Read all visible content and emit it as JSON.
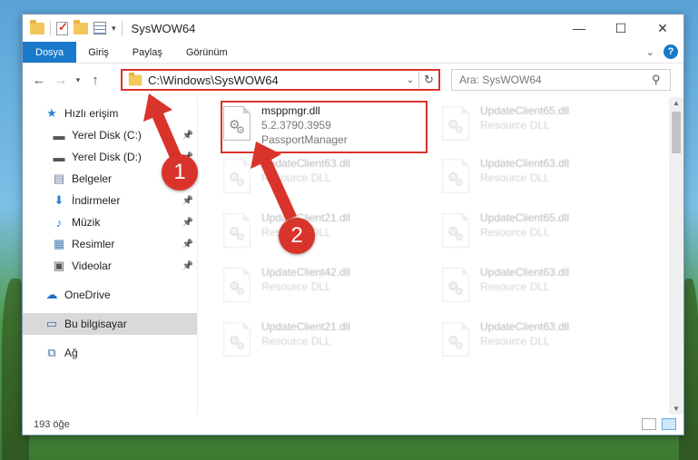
{
  "window": {
    "title": "SysWOW64",
    "controls": [
      "—",
      "☐",
      "✕"
    ]
  },
  "ribbon": {
    "tabs": [
      {
        "label": "Dosya",
        "active": true
      },
      {
        "label": "Giriş"
      },
      {
        "label": "Paylaş"
      },
      {
        "label": "Görünüm"
      }
    ],
    "help": "?"
  },
  "address": {
    "path": "C:\\Windows\\SysWOW64",
    "search_placeholder": "Ara: SysWOW64"
  },
  "sidebar": {
    "items": [
      {
        "label": "Hızlı erişim",
        "icon": "star-icon",
        "level": 0
      },
      {
        "label": "Yerel Disk (C:)",
        "icon": "drive-icon",
        "level": 1,
        "pinned": true
      },
      {
        "label": "Yerel Disk (D:)",
        "icon": "drive-icon",
        "level": 1,
        "pinned": true
      },
      {
        "label": "Belgeler",
        "icon": "documents-icon",
        "level": 1,
        "pinned": true
      },
      {
        "label": "İndirmeler",
        "icon": "download-icon",
        "level": 1,
        "pinned": true
      },
      {
        "label": "Müzik",
        "icon": "music-icon",
        "level": 1,
        "pinned": true
      },
      {
        "label": "Resimler",
        "icon": "pictures-icon",
        "level": 1,
        "pinned": true
      },
      {
        "label": "Videolar",
        "icon": "video-icon",
        "level": 1,
        "pinned": true
      },
      {
        "label": "OneDrive",
        "icon": "cloud-icon",
        "level": 0
      },
      {
        "label": "Bu bilgisayar",
        "icon": "computer-icon",
        "level": 0,
        "selected": true
      },
      {
        "label": "Ağ",
        "icon": "network-icon",
        "level": 0
      }
    ]
  },
  "files": [
    {
      "name": "msppmgr.dll",
      "line2": "5.2.3790.3959",
      "line3": "PassportManager",
      "faded": false
    },
    {
      "name": "UpdateClient65.dll",
      "line2": "Resource DLL",
      "faded": true
    },
    {
      "name": "UpdateClient63.dll",
      "line2": "Resource DLL",
      "faded": true
    },
    {
      "name": "UpdateClient63.dll",
      "line2": "Resource DLL",
      "faded": true
    },
    {
      "name": "UpdateClient21.dll",
      "line2": "Resource DLL",
      "faded": true
    },
    {
      "name": "UpdateClient65.dll",
      "line2": "Resource DLL",
      "faded": true
    },
    {
      "name": "UpdateClient42.dll",
      "line2": "Resource DLL",
      "faded": true
    },
    {
      "name": "UpdateClient63.dll",
      "line2": "Resource DLL",
      "faded": true
    },
    {
      "name": "UpdateClient21.dll",
      "line2": "Resource DLL",
      "faded": true
    },
    {
      "name": "UpdateClient63.dll",
      "line2": "Resource DLL",
      "faded": true
    }
  ],
  "status": {
    "count": "193 öğe"
  },
  "callouts": [
    "1",
    "2"
  ],
  "colors": {
    "accent": "#1979ca",
    "highlight": "#d9342b"
  }
}
